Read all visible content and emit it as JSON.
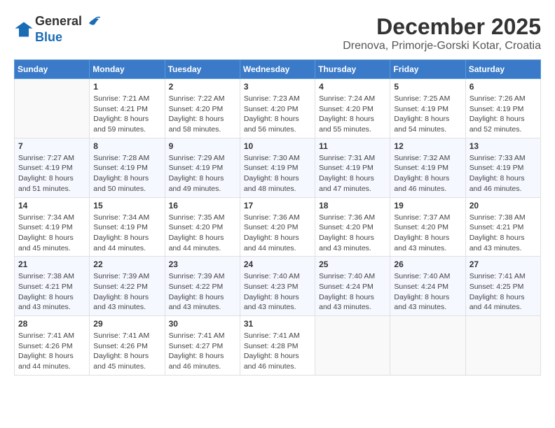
{
  "logo": {
    "general": "General",
    "blue": "Blue"
  },
  "title": "December 2025",
  "location": "Drenova, Primorje-Gorski Kotar, Croatia",
  "days_of_week": [
    "Sunday",
    "Monday",
    "Tuesday",
    "Wednesday",
    "Thursday",
    "Friday",
    "Saturday"
  ],
  "weeks": [
    [
      {
        "day": "",
        "info": ""
      },
      {
        "day": "1",
        "info": "Sunrise: 7:21 AM\nSunset: 4:21 PM\nDaylight: 8 hours\nand 59 minutes."
      },
      {
        "day": "2",
        "info": "Sunrise: 7:22 AM\nSunset: 4:20 PM\nDaylight: 8 hours\nand 58 minutes."
      },
      {
        "day": "3",
        "info": "Sunrise: 7:23 AM\nSunset: 4:20 PM\nDaylight: 8 hours\nand 56 minutes."
      },
      {
        "day": "4",
        "info": "Sunrise: 7:24 AM\nSunset: 4:20 PM\nDaylight: 8 hours\nand 55 minutes."
      },
      {
        "day": "5",
        "info": "Sunrise: 7:25 AM\nSunset: 4:19 PM\nDaylight: 8 hours\nand 54 minutes."
      },
      {
        "day": "6",
        "info": "Sunrise: 7:26 AM\nSunset: 4:19 PM\nDaylight: 8 hours\nand 52 minutes."
      }
    ],
    [
      {
        "day": "7",
        "info": "Sunrise: 7:27 AM\nSunset: 4:19 PM\nDaylight: 8 hours\nand 51 minutes."
      },
      {
        "day": "8",
        "info": "Sunrise: 7:28 AM\nSunset: 4:19 PM\nDaylight: 8 hours\nand 50 minutes."
      },
      {
        "day": "9",
        "info": "Sunrise: 7:29 AM\nSunset: 4:19 PM\nDaylight: 8 hours\nand 49 minutes."
      },
      {
        "day": "10",
        "info": "Sunrise: 7:30 AM\nSunset: 4:19 PM\nDaylight: 8 hours\nand 48 minutes."
      },
      {
        "day": "11",
        "info": "Sunrise: 7:31 AM\nSunset: 4:19 PM\nDaylight: 8 hours\nand 47 minutes."
      },
      {
        "day": "12",
        "info": "Sunrise: 7:32 AM\nSunset: 4:19 PM\nDaylight: 8 hours\nand 46 minutes."
      },
      {
        "day": "13",
        "info": "Sunrise: 7:33 AM\nSunset: 4:19 PM\nDaylight: 8 hours\nand 46 minutes."
      }
    ],
    [
      {
        "day": "14",
        "info": "Sunrise: 7:34 AM\nSunset: 4:19 PM\nDaylight: 8 hours\nand 45 minutes."
      },
      {
        "day": "15",
        "info": "Sunrise: 7:34 AM\nSunset: 4:19 PM\nDaylight: 8 hours\nand 44 minutes."
      },
      {
        "day": "16",
        "info": "Sunrise: 7:35 AM\nSunset: 4:20 PM\nDaylight: 8 hours\nand 44 minutes."
      },
      {
        "day": "17",
        "info": "Sunrise: 7:36 AM\nSunset: 4:20 PM\nDaylight: 8 hours\nand 44 minutes."
      },
      {
        "day": "18",
        "info": "Sunrise: 7:36 AM\nSunset: 4:20 PM\nDaylight: 8 hours\nand 43 minutes."
      },
      {
        "day": "19",
        "info": "Sunrise: 7:37 AM\nSunset: 4:20 PM\nDaylight: 8 hours\nand 43 minutes."
      },
      {
        "day": "20",
        "info": "Sunrise: 7:38 AM\nSunset: 4:21 PM\nDaylight: 8 hours\nand 43 minutes."
      }
    ],
    [
      {
        "day": "21",
        "info": "Sunrise: 7:38 AM\nSunset: 4:21 PM\nDaylight: 8 hours\nand 43 minutes."
      },
      {
        "day": "22",
        "info": "Sunrise: 7:39 AM\nSunset: 4:22 PM\nDaylight: 8 hours\nand 43 minutes."
      },
      {
        "day": "23",
        "info": "Sunrise: 7:39 AM\nSunset: 4:22 PM\nDaylight: 8 hours\nand 43 minutes."
      },
      {
        "day": "24",
        "info": "Sunrise: 7:40 AM\nSunset: 4:23 PM\nDaylight: 8 hours\nand 43 minutes."
      },
      {
        "day": "25",
        "info": "Sunrise: 7:40 AM\nSunset: 4:24 PM\nDaylight: 8 hours\nand 43 minutes."
      },
      {
        "day": "26",
        "info": "Sunrise: 7:40 AM\nSunset: 4:24 PM\nDaylight: 8 hours\nand 43 minutes."
      },
      {
        "day": "27",
        "info": "Sunrise: 7:41 AM\nSunset: 4:25 PM\nDaylight: 8 hours\nand 44 minutes."
      }
    ],
    [
      {
        "day": "28",
        "info": "Sunrise: 7:41 AM\nSunset: 4:26 PM\nDaylight: 8 hours\nand 44 minutes."
      },
      {
        "day": "29",
        "info": "Sunrise: 7:41 AM\nSunset: 4:26 PM\nDaylight: 8 hours\nand 45 minutes."
      },
      {
        "day": "30",
        "info": "Sunrise: 7:41 AM\nSunset: 4:27 PM\nDaylight: 8 hours\nand 46 minutes."
      },
      {
        "day": "31",
        "info": "Sunrise: 7:41 AM\nSunset: 4:28 PM\nDaylight: 8 hours\nand 46 minutes."
      },
      {
        "day": "",
        "info": ""
      },
      {
        "day": "",
        "info": ""
      },
      {
        "day": "",
        "info": ""
      }
    ]
  ]
}
